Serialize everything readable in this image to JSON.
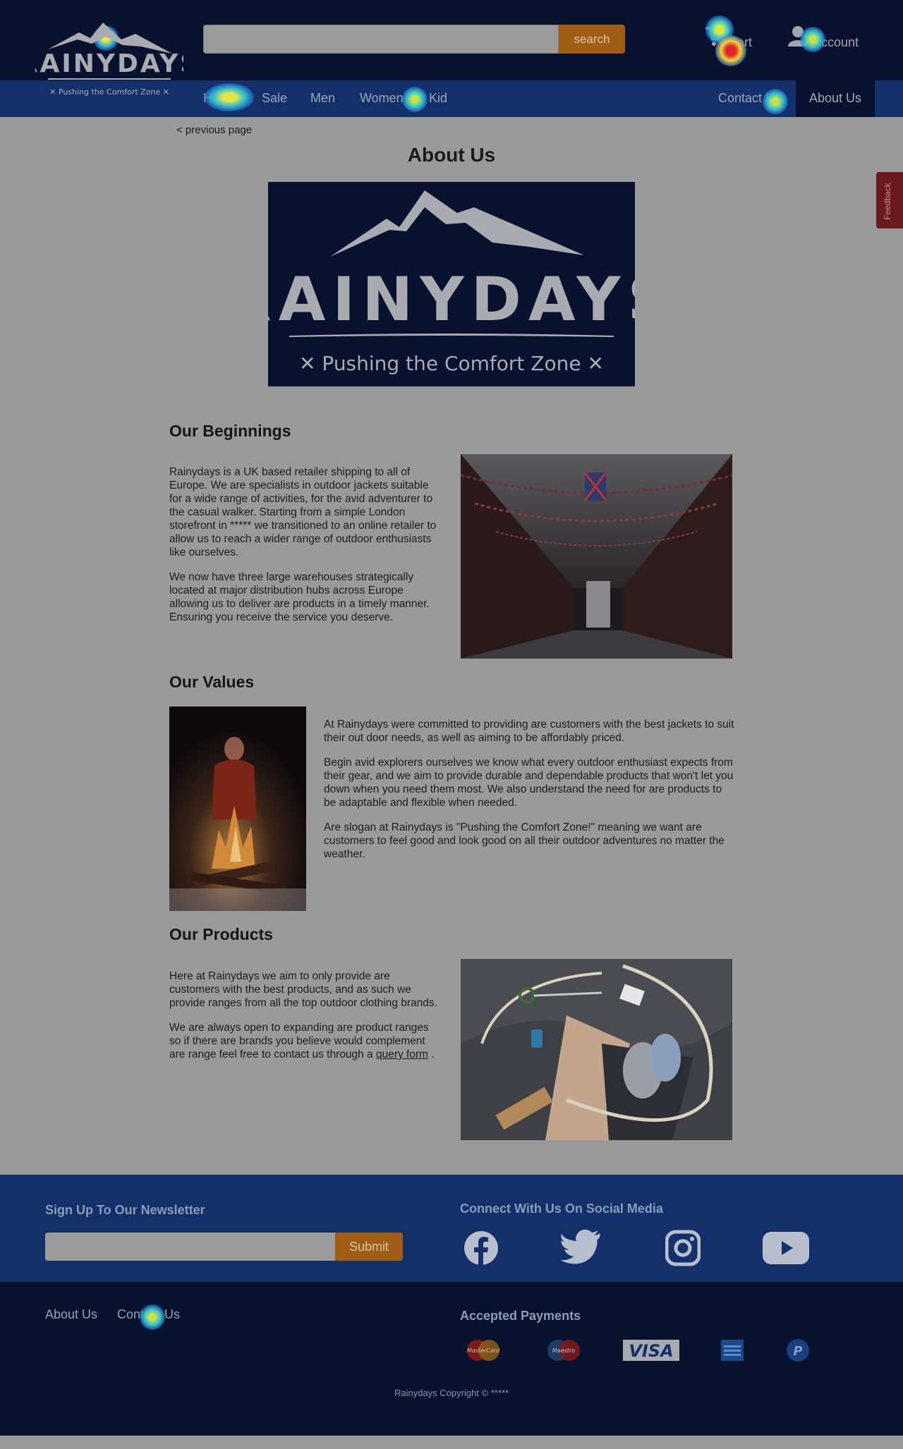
{
  "brand": {
    "name": "RAINYDAYS",
    "tagline": "Pushing the Comfort Zone"
  },
  "header": {
    "search": {
      "value": "",
      "placeholder": "",
      "button_label": "search"
    },
    "cart_label": "Cart",
    "account_label": "Account"
  },
  "nav": {
    "items": [
      "Home",
      "Sale",
      "Men",
      "Women",
      "Kid"
    ],
    "contact": "Contact Us",
    "about": "About Us"
  },
  "feedback_label": "Feedback",
  "main": {
    "prev_link": "< previous page",
    "title": "About Us",
    "beginnings": {
      "heading": "Our Beginnings",
      "p1": "Rainydays is a UK based retailer shipping to all of Europe. We are specialists in outdoor jackets suitable for a wide range of activities, for the avid adventurer to the casual walker. Starting from a simple London storefront in ***** we transitioned to an online retailer to allow us to reach a wider range of outdoor enthusiasts like ourselves.",
      "p2": "We now have three large warehouses strategically located at major distribution hubs across Europe allowing us to deliver are products in a timely manner. Ensuring you receive the service you deserve."
    },
    "values": {
      "heading": "Our Values",
      "p1": "At Rainydays were committed to providing are customers with the best jackets to suit their out door needs, as well as aiming to be affordably priced.",
      "p2": "Begin avid explorers ourselves we know what every outdoor enthusiast expects from their gear, and we aim to provide durable and dependable products that won't let you down when you need them most. We also understand the need for are products to be adaptable and flexible when needed.",
      "p3": "Are slogan at Rainydays is \"Pushing the Comfort Zone!\" meaning we want are customers to feel good and look good on all their outdoor adventures no matter the weather."
    },
    "products": {
      "heading": "Our Products",
      "p1": "Here at Rainydays we aim to only provide are customers with the best products, and as such we provide ranges from all the top outdoor clothing brands.",
      "p2_start": "We are always open to expanding are product ranges so if there are brands you believe would complement are range feel free to contact us through a ",
      "p2_link": "query form",
      "p2_end": " ."
    }
  },
  "footer": {
    "newsletter_heading": "Sign Up To Our Newsletter",
    "newsletter_value": "",
    "submit_label": "Submit",
    "social_heading": "Connect With Us On Social Media",
    "social_icons": [
      "facebook-icon",
      "twitter-icon",
      "instagram-icon",
      "youtube-icon"
    ],
    "links": [
      "About Us",
      "Contact Us"
    ],
    "payments_heading": "Accepted Payments",
    "payment_badges": {
      "mastercard": "MasterCard",
      "maestro": "Maestro",
      "visa": "VISA"
    },
    "payment_icons": [
      "mastercard-icon",
      "maestro-icon",
      "visa-icon",
      "amex-icon",
      "paypal-icon"
    ],
    "copyright": "Rainydays Copyright © *****"
  },
  "colors": {
    "header_dark": "#08122e",
    "nav_blue": "#14306b",
    "button_orange": "#a05d14",
    "page_bg": "#9a9a9a"
  }
}
